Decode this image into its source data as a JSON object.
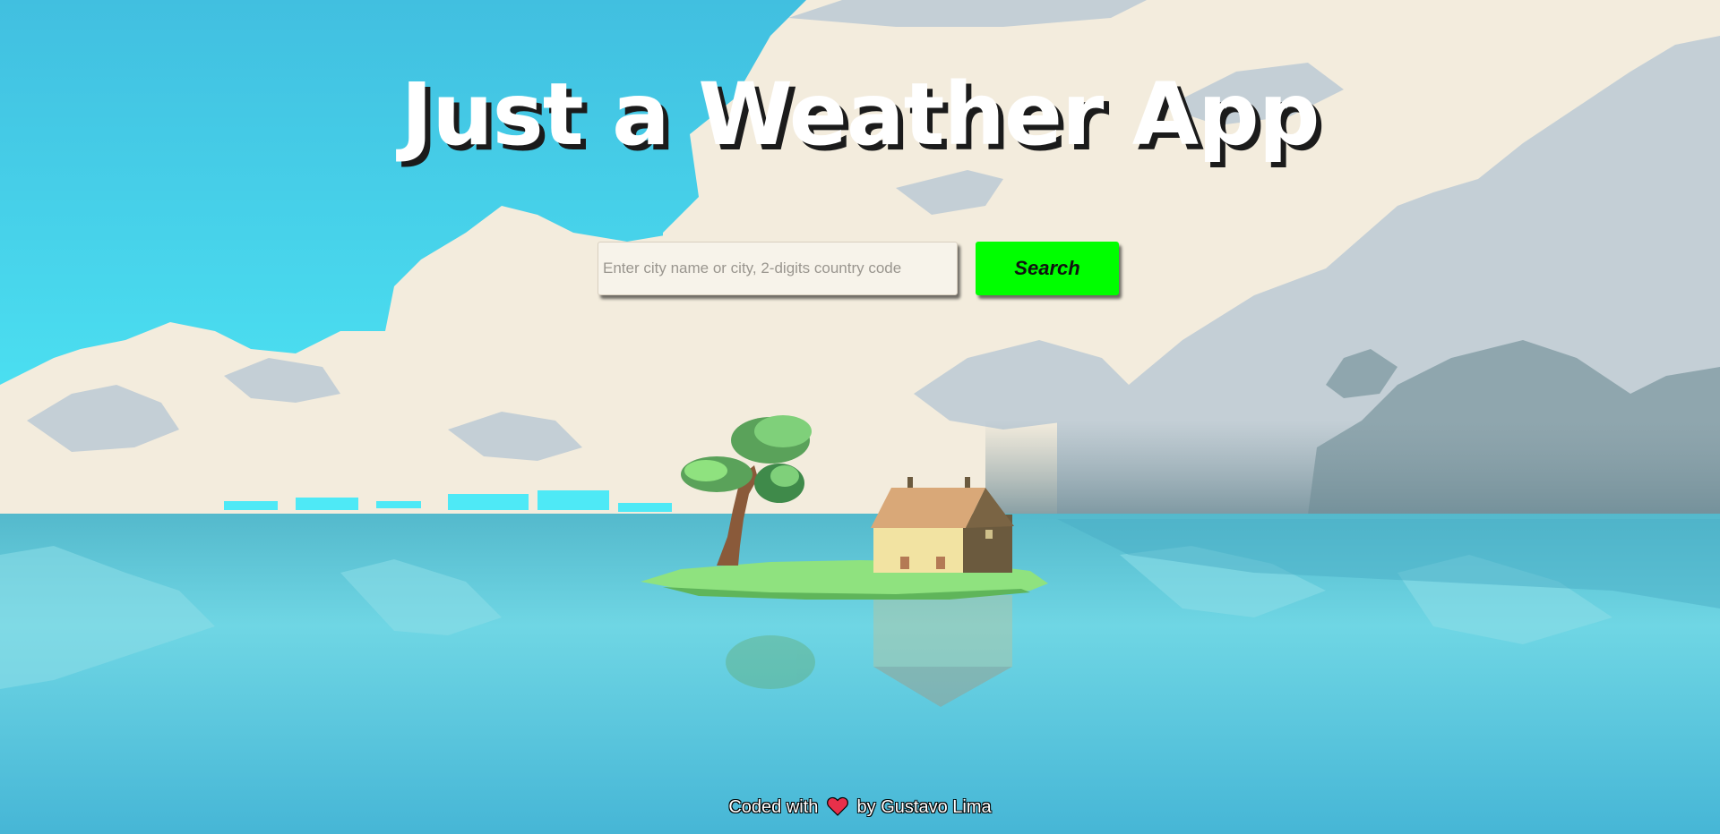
{
  "header": {
    "title": "Just a Weather App"
  },
  "search": {
    "placeholder": "Enter city name or city, 2-digits country code",
    "value": "",
    "button_label": "Search"
  },
  "footer": {
    "prefix": "Coded with",
    "icon": "heart-icon",
    "suffix": "by Gustavo Lima"
  },
  "colors": {
    "sky_top": "#45c3e3",
    "sky_bottom": "#4fe8f5",
    "cloud_light": "#f3ecdd",
    "cloud_grey": "#c4cfd6",
    "cloud_dark": "#8fa6ae",
    "water": "#5cc6d8",
    "search_button": "#00ff00",
    "title_text": "#ffffff"
  },
  "background": {
    "scene_icons": [
      "tree-icon",
      "house-icon",
      "island-icon"
    ]
  }
}
